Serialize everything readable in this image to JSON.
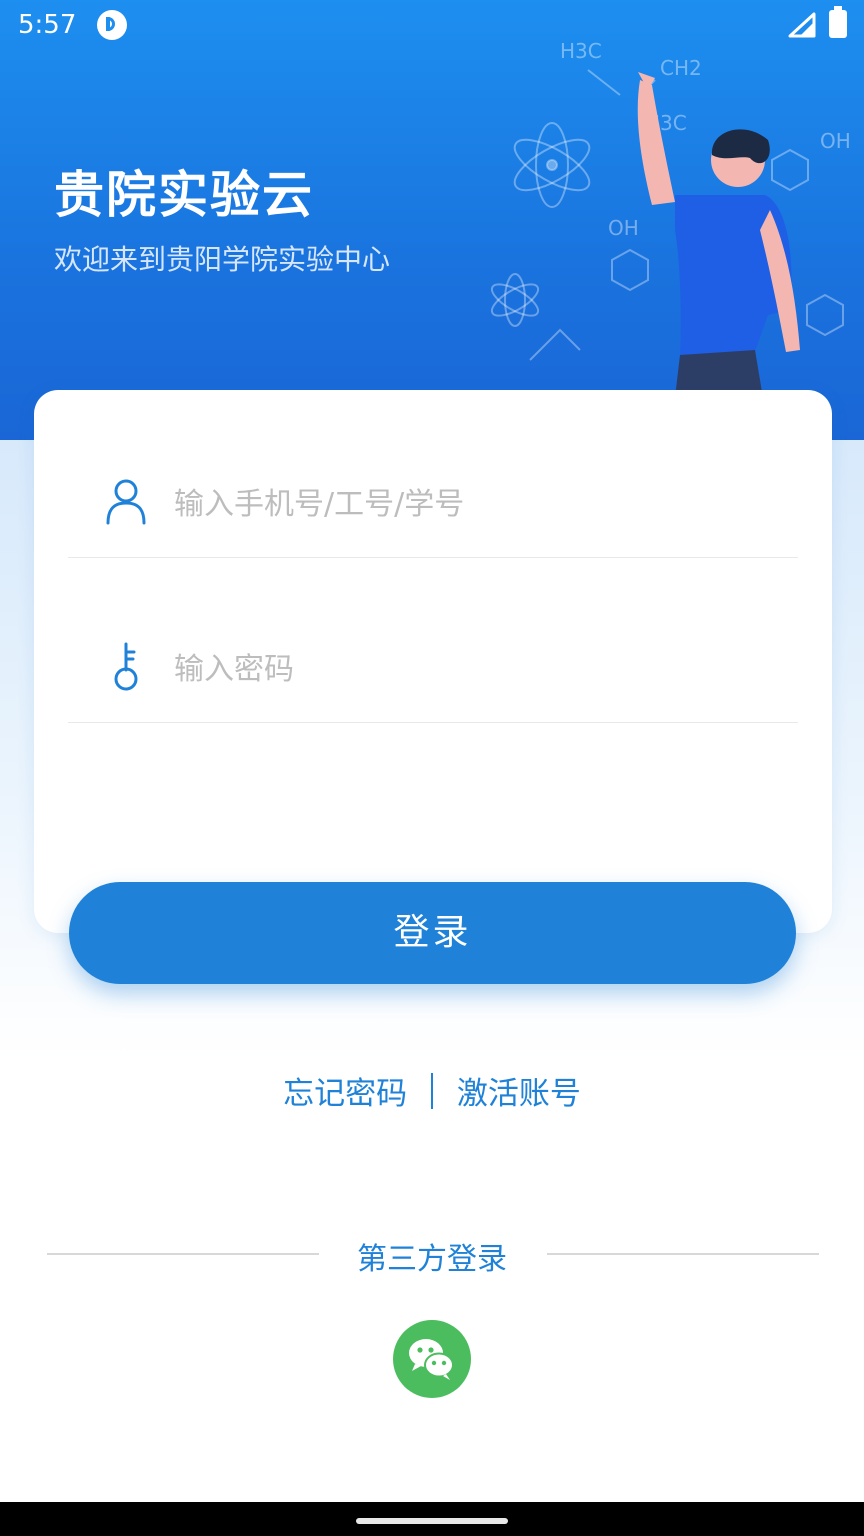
{
  "status_bar": {
    "time": "5:57",
    "icons": [
      "app-badge-icon",
      "signal-icon",
      "battery-icon"
    ]
  },
  "header": {
    "title": "贵院实验云",
    "subtitle": "欢迎来到贵阳学院实验中心"
  },
  "form": {
    "account_placeholder": "输入手机号/工号/学号",
    "password_placeholder": "输入密码",
    "login_label": "登录"
  },
  "links": {
    "forgot_password": "忘记密码",
    "activate_account": "激活账号"
  },
  "third_party": {
    "label": "第三方登录",
    "providers": [
      "wechat-icon"
    ]
  },
  "colors": {
    "primary": "#1f82d8",
    "hero_top": "#1d8ff0",
    "hero_bottom": "#1a66d6",
    "wechat_green": "#4cbd5f"
  }
}
